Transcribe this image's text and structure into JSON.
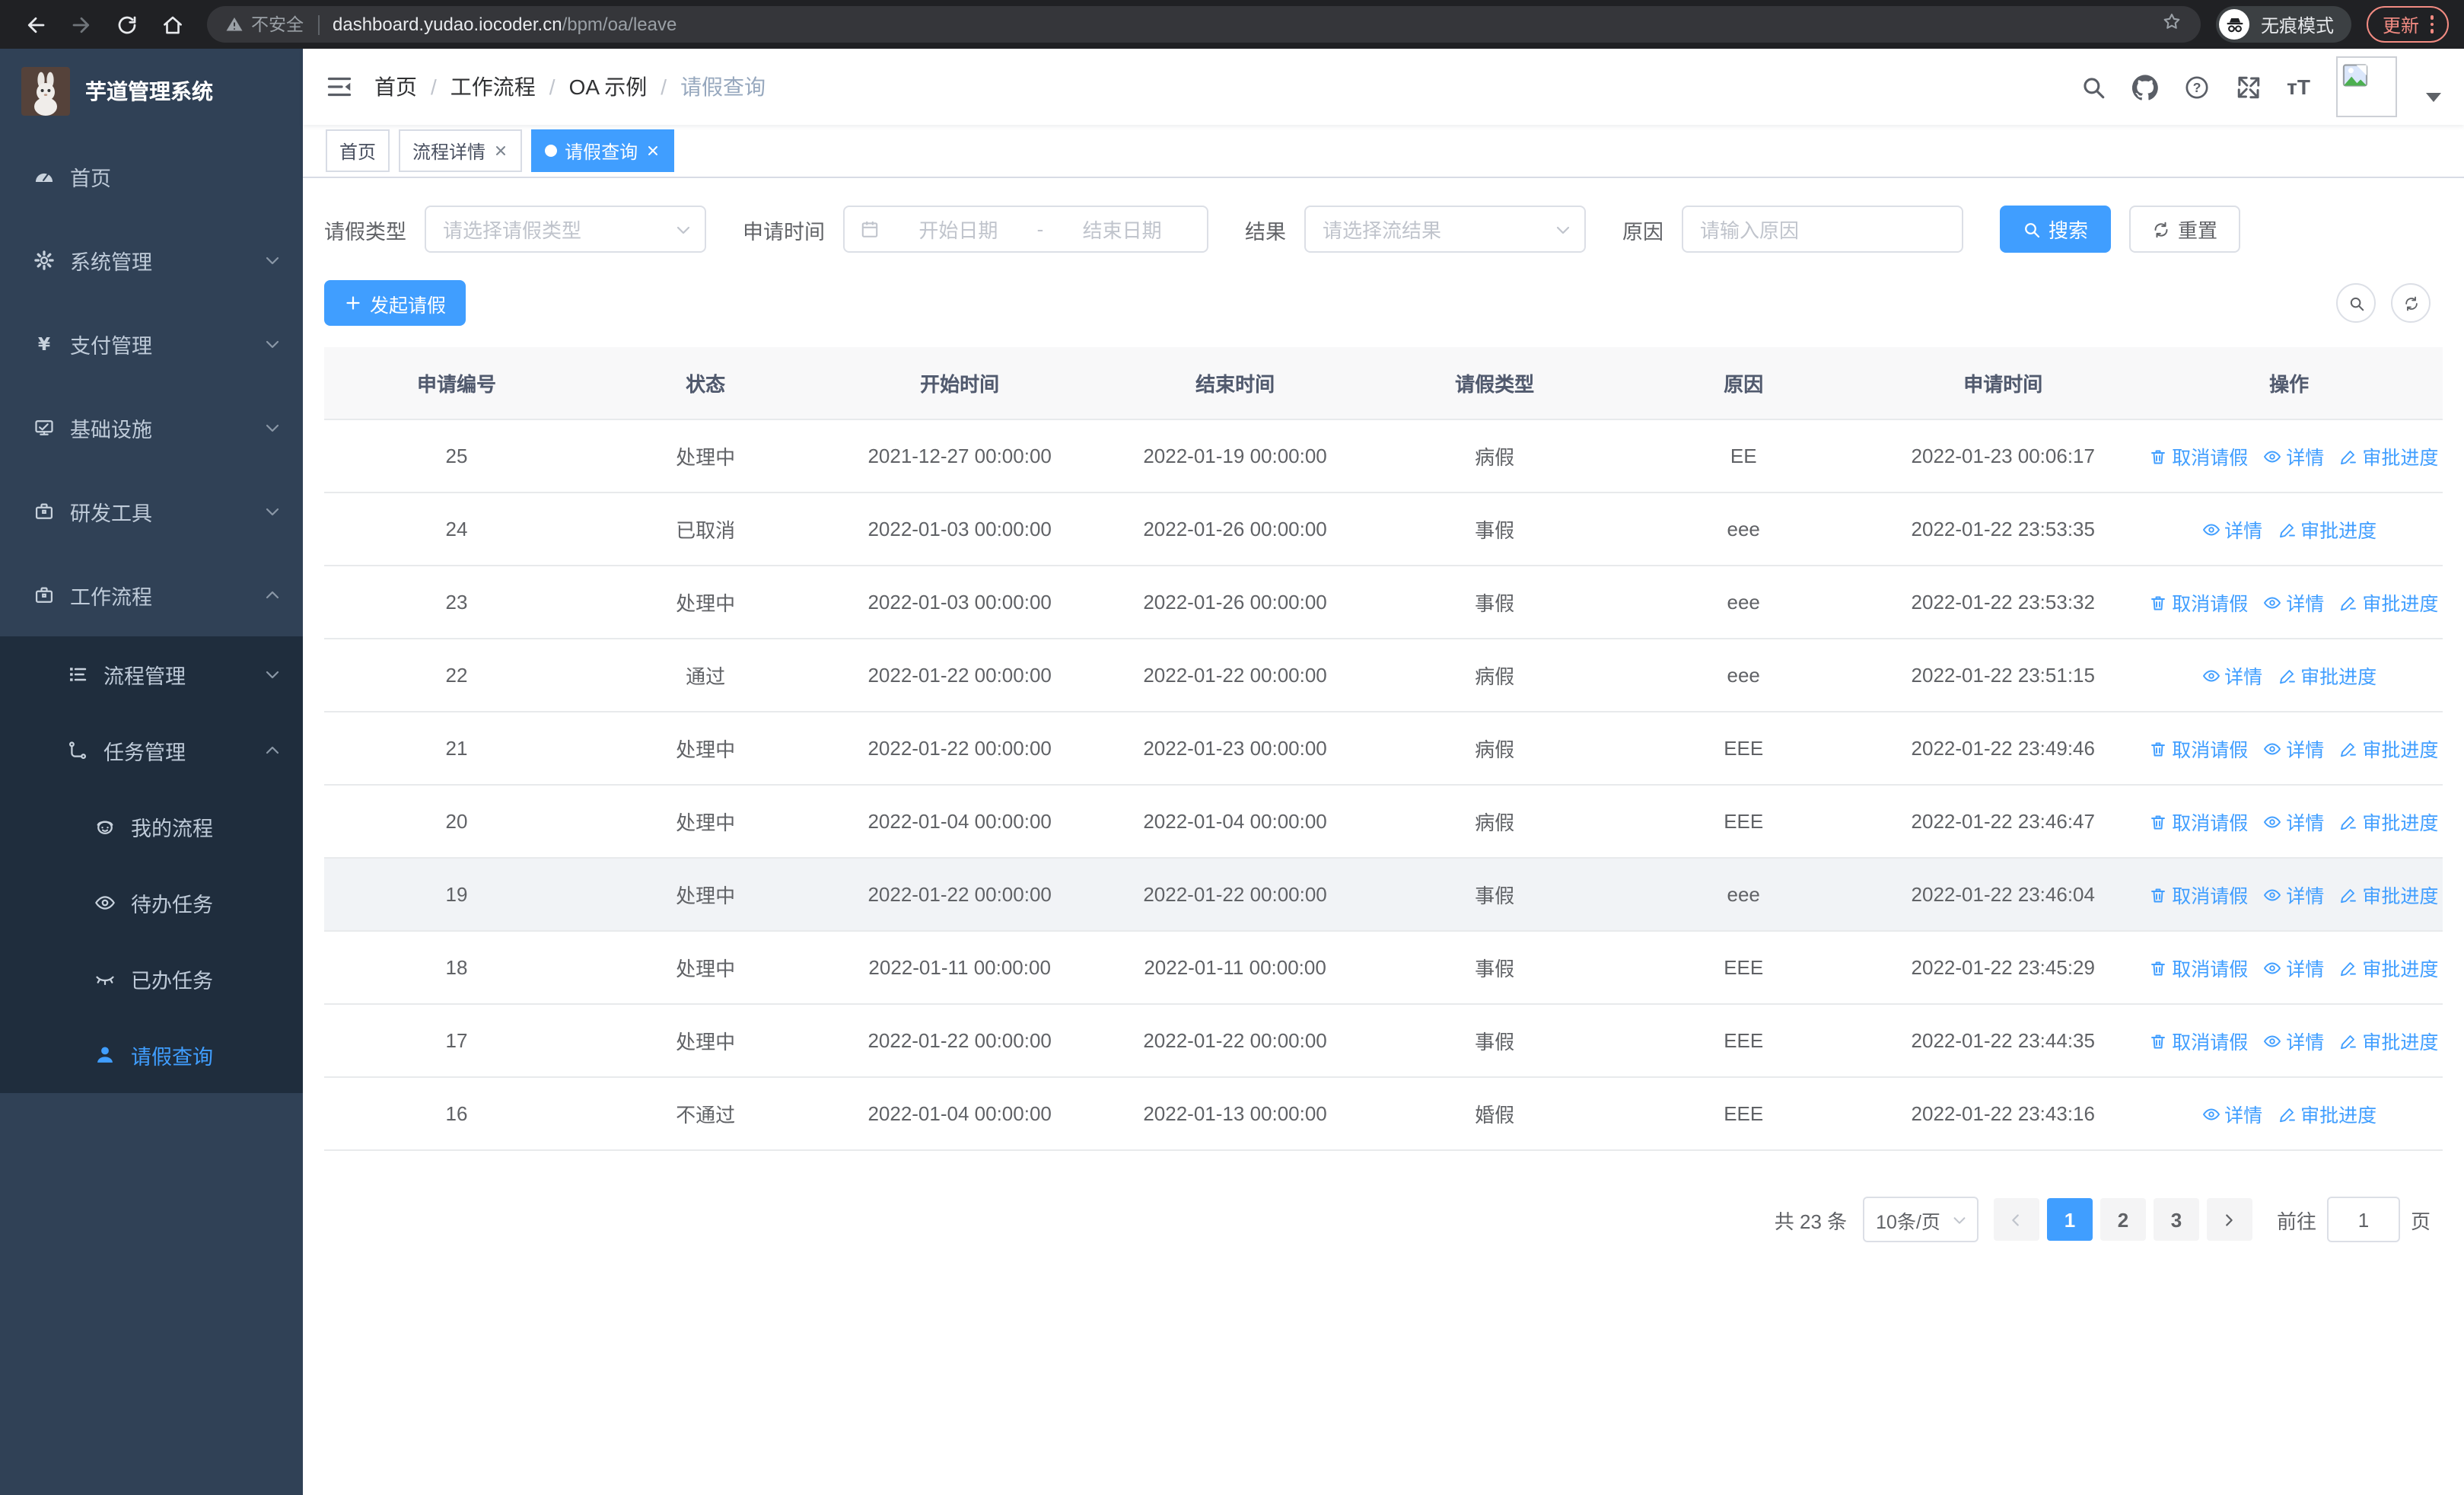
{
  "browser": {
    "security_label": "不安全",
    "url_host": "dashboard.yudao.iocoder.cn",
    "url_path": "/bpm/oa/leave",
    "incognito_label": "无痕模式",
    "update_label": "更新"
  },
  "sidebar": {
    "title": "芋道管理系统",
    "items": [
      {
        "label": "首页"
      },
      {
        "label": "系统管理"
      },
      {
        "label": "支付管理"
      },
      {
        "label": "基础设施"
      },
      {
        "label": "研发工具"
      },
      {
        "label": "工作流程"
      },
      {
        "label": "流程管理"
      },
      {
        "label": "任务管理"
      },
      {
        "label": "我的流程"
      },
      {
        "label": "待办任务"
      },
      {
        "label": "已办任务"
      },
      {
        "label": "请假查询"
      }
    ]
  },
  "header": {
    "breadcrumb": [
      "首页",
      "工作流程",
      "OA 示例",
      "请假查询"
    ],
    "separator": "/"
  },
  "tags": [
    {
      "label": "首页"
    },
    {
      "label": "流程详情"
    },
    {
      "label": "请假查询"
    }
  ],
  "filters": {
    "leave_type_label": "请假类型",
    "leave_type_placeholder": "请选择请假类型",
    "apply_time_label": "申请时间",
    "start_date_placeholder": "开始日期",
    "range_separator": "-",
    "end_date_placeholder": "结束日期",
    "result_label": "结果",
    "result_placeholder": "请选择流结果",
    "reason_label": "原因",
    "reason_placeholder": "请输入原因",
    "search_label": "搜索",
    "reset_label": "重置"
  },
  "toolbar": {
    "create_label": "发起请假"
  },
  "table": {
    "headers": [
      "申请编号",
      "状态",
      "开始时间",
      "结束时间",
      "请假类型",
      "原因",
      "申请时间",
      "操作"
    ],
    "action_labels": {
      "cancel": "取消请假",
      "detail": "详情",
      "progress": "审批进度"
    },
    "rows": [
      {
        "id": "25",
        "status": "处理中",
        "start": "2021-12-27 00:00:00",
        "end": "2022-01-19 00:00:00",
        "type": "病假",
        "reason": "EE",
        "applied": "2022-01-23 00:06:17",
        "actions": [
          "cancel",
          "detail",
          "progress"
        ]
      },
      {
        "id": "24",
        "status": "已取消",
        "start": "2022-01-03 00:00:00",
        "end": "2022-01-26 00:00:00",
        "type": "事假",
        "reason": "eee",
        "applied": "2022-01-22 23:53:35",
        "actions": [
          "detail",
          "progress"
        ]
      },
      {
        "id": "23",
        "status": "处理中",
        "start": "2022-01-03 00:00:00",
        "end": "2022-01-26 00:00:00",
        "type": "事假",
        "reason": "eee",
        "applied": "2022-01-22 23:53:32",
        "actions": [
          "cancel",
          "detail",
          "progress"
        ]
      },
      {
        "id": "22",
        "status": "通过",
        "start": "2022-01-22 00:00:00",
        "end": "2022-01-22 00:00:00",
        "type": "病假",
        "reason": "eee",
        "applied": "2022-01-22 23:51:15",
        "actions": [
          "detail",
          "progress"
        ]
      },
      {
        "id": "21",
        "status": "处理中",
        "start": "2022-01-22 00:00:00",
        "end": "2022-01-23 00:00:00",
        "type": "病假",
        "reason": "EEE",
        "applied": "2022-01-22 23:49:46",
        "actions": [
          "cancel",
          "detail",
          "progress"
        ]
      },
      {
        "id": "20",
        "status": "处理中",
        "start": "2022-01-04 00:00:00",
        "end": "2022-01-04 00:00:00",
        "type": "病假",
        "reason": "EEE",
        "applied": "2022-01-22 23:46:47",
        "actions": [
          "cancel",
          "detail",
          "progress"
        ]
      },
      {
        "id": "19",
        "status": "处理中",
        "start": "2022-01-22 00:00:00",
        "end": "2022-01-22 00:00:00",
        "type": "事假",
        "reason": "eee",
        "applied": "2022-01-22 23:46:04",
        "actions": [
          "cancel",
          "detail",
          "progress"
        ],
        "highlighted": true
      },
      {
        "id": "18",
        "status": "处理中",
        "start": "2022-01-11 00:00:00",
        "end": "2022-01-11 00:00:00",
        "type": "事假",
        "reason": "EEE",
        "applied": "2022-01-22 23:45:29",
        "actions": [
          "cancel",
          "detail",
          "progress"
        ]
      },
      {
        "id": "17",
        "status": "处理中",
        "start": "2022-01-22 00:00:00",
        "end": "2022-01-22 00:00:00",
        "type": "事假",
        "reason": "EEE",
        "applied": "2022-01-22 23:44:35",
        "actions": [
          "cancel",
          "detail",
          "progress"
        ]
      },
      {
        "id": "16",
        "status": "不通过",
        "start": "2022-01-04 00:00:00",
        "end": "2022-01-13 00:00:00",
        "type": "婚假",
        "reason": "EEE",
        "applied": "2022-01-22 23:43:16",
        "actions": [
          "detail",
          "progress"
        ]
      }
    ]
  },
  "pagination": {
    "total": "共 23 条",
    "page_size": "10条/页",
    "pages": [
      "1",
      "2",
      "3"
    ],
    "active_page": "1",
    "goto_label": "前往",
    "goto_value": "1",
    "goto_suffix": "页"
  },
  "colors": {
    "accent": "#409eff",
    "sidebar_bg": "#304156",
    "submenu_bg": "#1f2d3d",
    "chrome_bg": "#202124",
    "update_accent": "#f28b82"
  }
}
